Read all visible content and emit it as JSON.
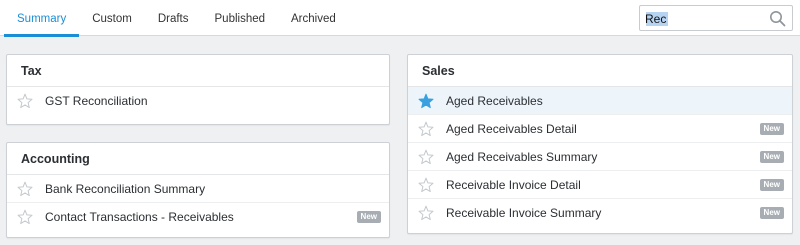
{
  "tabs": [
    "Summary",
    "Custom",
    "Drafts",
    "Published",
    "Archived"
  ],
  "search": {
    "value": "Rec",
    "icon": "magnifier-icon"
  },
  "colors": {
    "accent": "#1b8fd6",
    "star_filled": "#3aa0e0",
    "badge": "#a7adb3"
  },
  "panels": {
    "tax": {
      "title": "Tax",
      "items": [
        {
          "label": "GST Reconciliation",
          "starred": false,
          "badge": ""
        }
      ]
    },
    "accounting": {
      "title": "Accounting",
      "items": [
        {
          "label": "Bank Reconciliation Summary",
          "starred": false,
          "badge": ""
        },
        {
          "label": "Contact Transactions - Receivables",
          "starred": false,
          "badge": "New"
        }
      ]
    },
    "sales": {
      "title": "Sales",
      "items": [
        {
          "label": "Aged Receivables",
          "starred": true,
          "badge": ""
        },
        {
          "label": "Aged Receivables Detail",
          "starred": false,
          "badge": "New"
        },
        {
          "label": "Aged Receivables Summary",
          "starred": false,
          "badge": "New"
        },
        {
          "label": "Receivable Invoice Detail",
          "starred": false,
          "badge": "New"
        },
        {
          "label": "Receivable Invoice Summary",
          "starred": false,
          "badge": "New"
        }
      ]
    }
  }
}
